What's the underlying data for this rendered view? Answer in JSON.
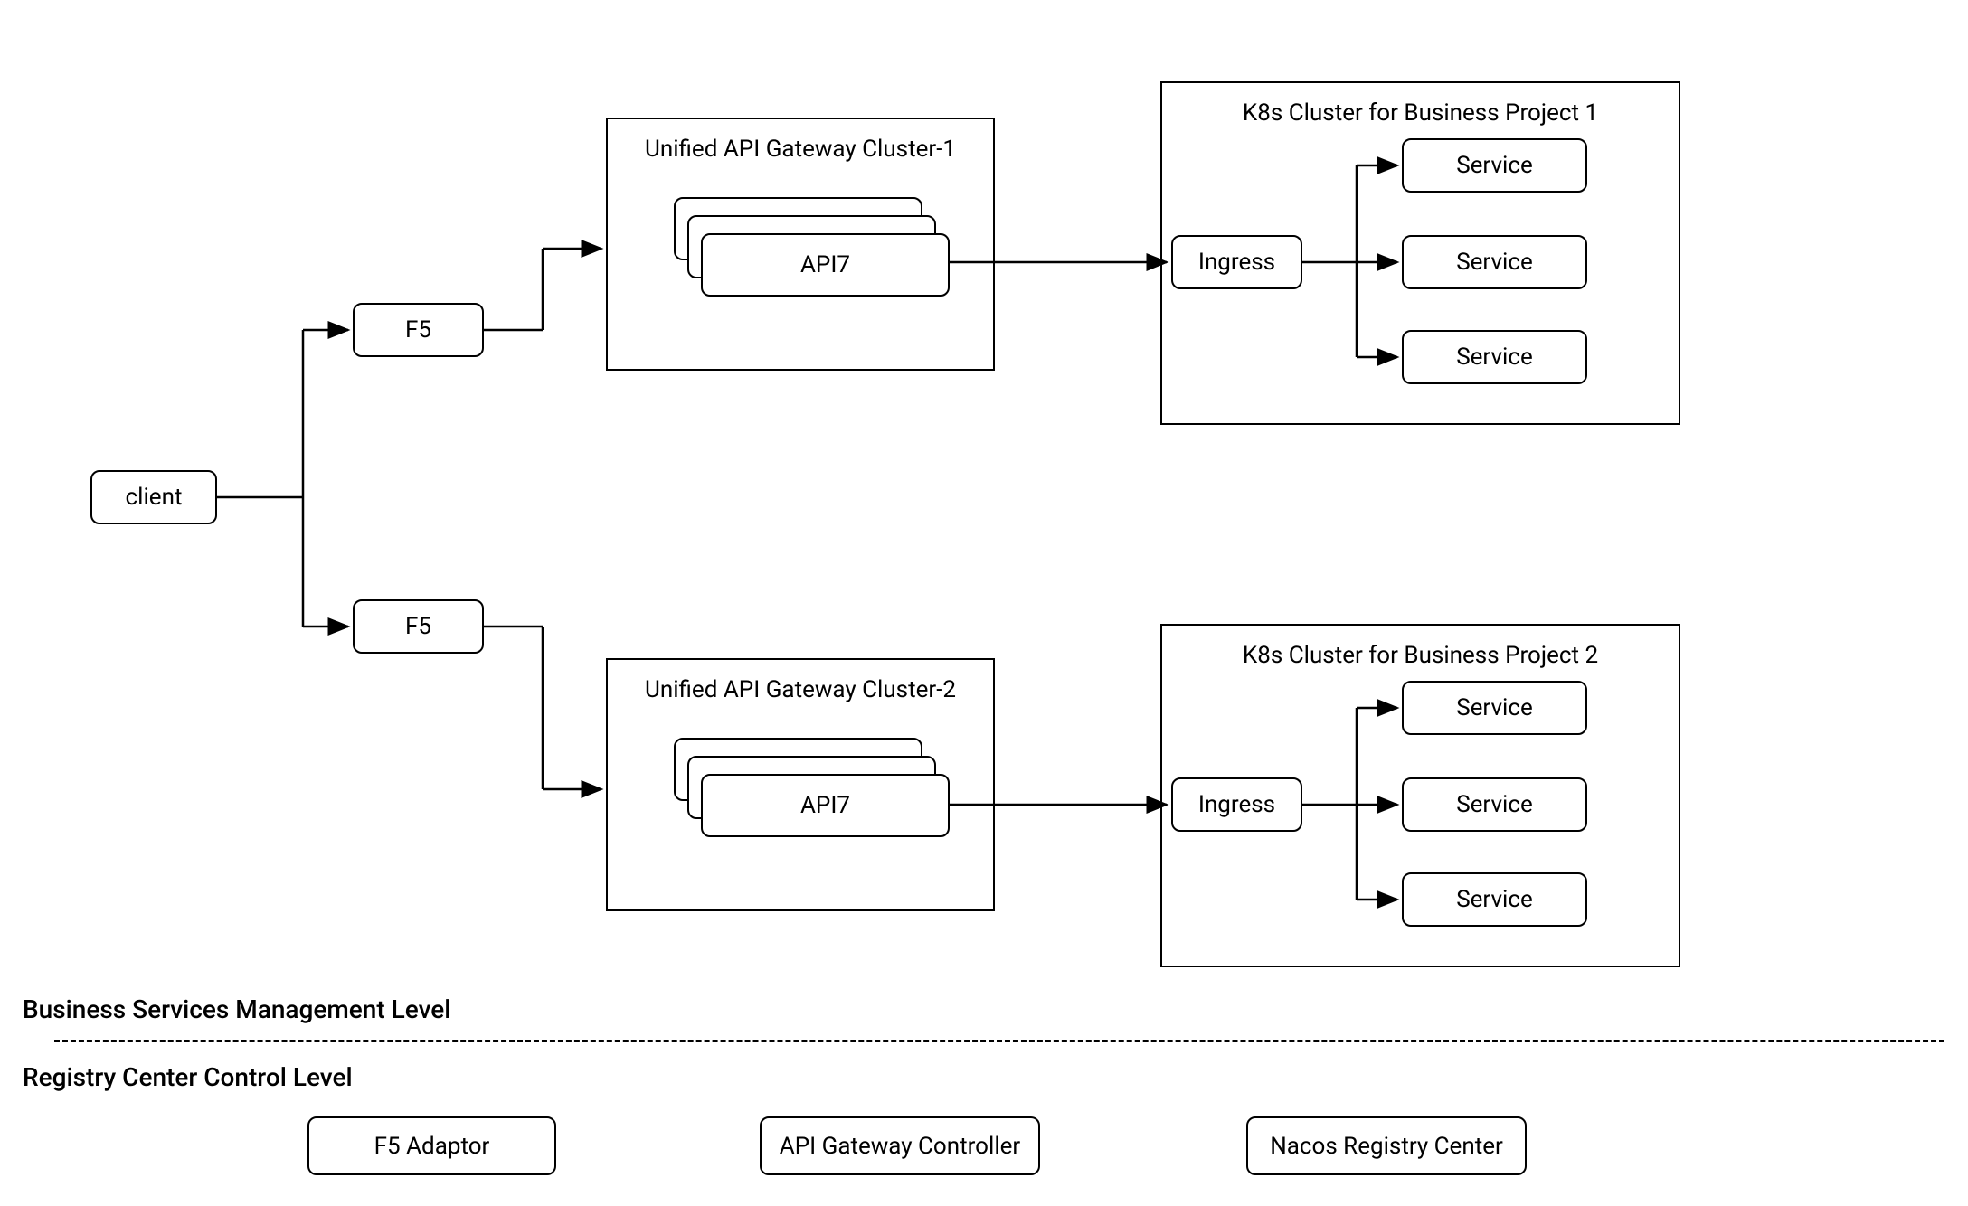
{
  "nodes": {
    "client": "client",
    "f5_1": "F5",
    "f5_2": "F5",
    "api7_1": "API7",
    "api7_2": "API7",
    "ingress_1": "Ingress",
    "ingress_2": "Ingress",
    "service_1a": "Service",
    "service_1b": "Service",
    "service_1c": "Service",
    "service_2a": "Service",
    "service_2b": "Service",
    "service_2c": "Service"
  },
  "containers": {
    "gateway_1": "Unified API Gateway Cluster-1",
    "gateway_2": "Unified API Gateway Cluster-2",
    "k8s_1": "K8s Cluster for Business Project 1",
    "k8s_2": "K8s Cluster for Business Project 2"
  },
  "labels": {
    "business_level": "Business Services Management Level",
    "registry_level": "Registry Center Control Level"
  },
  "registry_nodes": {
    "f5_adaptor": "F5 Adaptor",
    "api_controller": "API Gateway Controller",
    "nacos": "Nacos Registry Center"
  }
}
